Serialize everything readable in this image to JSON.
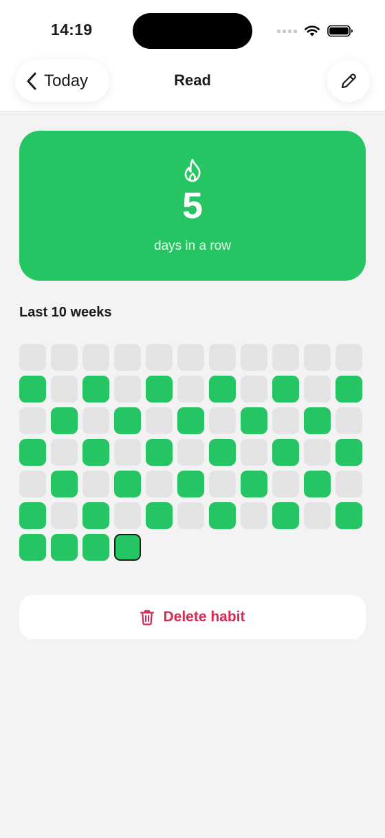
{
  "status_bar": {
    "time": "14:19"
  },
  "nav": {
    "back_label": "Today",
    "title": "Read"
  },
  "streak": {
    "count": "5",
    "caption": "days in a row"
  },
  "history": {
    "title": "Last 10 weeks",
    "columns": 11,
    "rows": [
      [
        0,
        0,
        0,
        0,
        0,
        0,
        0,
        0,
        0,
        0,
        0
      ],
      [
        1,
        0,
        1,
        0,
        1,
        0,
        1,
        0,
        1,
        0,
        1
      ],
      [
        0,
        1,
        0,
        1,
        0,
        1,
        0,
        1,
        0,
        1,
        0
      ],
      [
        1,
        0,
        1,
        0,
        1,
        0,
        1,
        0,
        1,
        0,
        1
      ],
      [
        0,
        1,
        0,
        1,
        0,
        1,
        0,
        1,
        0,
        1,
        0
      ],
      [
        1,
        0,
        1,
        0,
        1,
        0,
        1,
        0,
        1,
        0,
        1
      ],
      [
        1,
        1,
        1,
        1
      ]
    ],
    "today_row": 6,
    "today_col": 3
  },
  "actions": {
    "delete_label": "Delete habit"
  },
  "colors": {
    "done": "#24c562",
    "empty": "#e3e3e6",
    "danger": "#d42a55",
    "background": "#f3f3f3"
  },
  "icons": {
    "back": "chevron-left-icon",
    "edit": "pencil-icon",
    "streak": "flame-icon",
    "delete": "trash-icon"
  }
}
